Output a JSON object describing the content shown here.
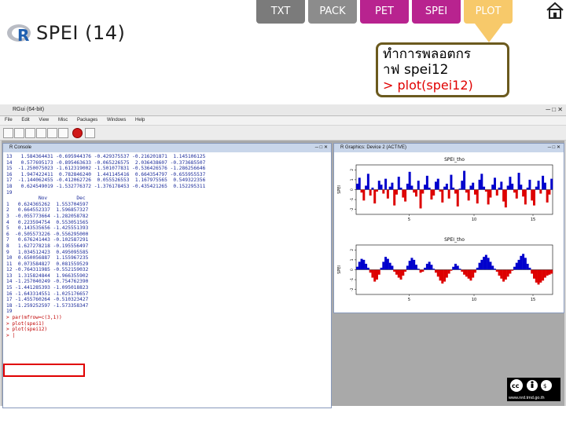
{
  "nav": {
    "tabs": [
      {
        "label": "TXT"
      },
      {
        "label": "PACK"
      },
      {
        "label": "PET"
      },
      {
        "label": "SPEI"
      },
      {
        "label": "PLOT"
      }
    ]
  },
  "slide": {
    "title": "SPEI (14)",
    "callout": {
      "line1": "ทำการพลอตกร",
      "line2": "าฟ spei12",
      "line3": "> plot(spei12)"
    }
  },
  "rgui": {
    "window_title": "RGui (64-bit)",
    "menu": [
      "File",
      "Edit",
      "View",
      "Misc",
      "Packages",
      "Windows",
      "Help"
    ],
    "console_title": "R Console",
    "graphics_title": "R Graphics: Device 2 (ACTIVE)",
    "console_lines": [
      "13   1.584364431 -0.695944376 -0.429375537 -0.216201871  1.145106125",
      "14   0.577695173 -0.895463633 -0.065226575  2.036438607 -0.373685507",
      "15  -1.250075023 -1.612319002 -1.501077831 -0.536426576 -1.286256646",
      "16   1.947422411  0.782846240  1.441145416  0.664354797 -0.655955537",
      "17  -1.144062455 -0.412062726  0.055526553  1.167975565  0.549322356",
      "18   0.624549019 -1.532776372 -1.376178453 -0.435421265  0.152295311",
      "19",
      "           Nov          Dec",
      "1   0.624365262  1.553704597",
      "2   0.664552337  1.596857327",
      "3  -0.055773664 -1.282058782",
      "4   0.223594754  0.553051565",
      "5   0.143535656 -1.425551393",
      "6  -0.505573226 -0.556295000",
      "7   0.676241443 -0.102587291",
      "8   1.627278218 -0.195556497",
      "9   1.034512423  0.495095585",
      "10  0.650056887  1.155967235",
      "11  0.073584827  0.081559529",
      "12 -0.764311985 -0.552159032",
      "13  1.315824844  1.966355902",
      "14 -1.257040249 -0.754762390",
      "15 -1.441285393 -1.095018823",
      "16 -1.643314551 -1.025176657",
      "17 -1.455760264 -0.510323427",
      "18 -1.259252597 -1.573358347",
      "19"
    ],
    "console_commands": [
      "> par(mfrow=c(3,1))",
      "> plot(spei1)",
      "> plot(spei12)",
      "> |"
    ],
    "plots": [
      {
        "title": "SPEI_tho",
        "ylabel": "SPEI",
        "y_ticks": [
          "2",
          "1",
          "0",
          "-1",
          "-2"
        ],
        "x_ticks": [
          "5",
          "10",
          "15"
        ],
        "ylim": [
          -2.5,
          2.5
        ],
        "series": [
          0.6,
          1.2,
          -0.3,
          -1.1,
          0.4,
          1.6,
          -0.6,
          0.2,
          -1.4,
          -0.2,
          0.9,
          0.5,
          -0.4,
          1.1,
          -0.9,
          0.3,
          0.7,
          -1.6,
          -0.5,
          1.3,
          0.2,
          -0.8,
          -1.2,
          0.6,
          1.8,
          0.4,
          -0.3,
          -0.7,
          0.9,
          -1.9,
          -0.4,
          0.5,
          1.4,
          0.2,
          -1.0,
          -0.6,
          0.8,
          1.1,
          -0.2,
          -1.3,
          0.3,
          0.6,
          -0.9,
          1.5,
          0.2,
          -0.4,
          -1.7,
          0.1,
          0.9,
          1.9,
          -0.3,
          -1.1,
          0.4,
          0.7,
          -0.5,
          -1.4,
          1.0,
          1.6,
          0.3,
          -0.2,
          -1.5,
          -0.8,
          0.5,
          1.2,
          -0.6,
          0.2,
          0.8,
          -1.2,
          -1.8,
          0.4,
          1.3,
          0.6,
          -0.3,
          -0.9,
          1.7,
          0.5,
          -0.7,
          -1.5,
          0.2,
          1.0,
          -1.1,
          -1.6,
          0.3,
          0.9,
          -0.4,
          1.4,
          0.7,
          -1.3,
          -0.5,
          1.1
        ],
        "positive_color": "#0000cc",
        "negative_color": "#dd0000"
      },
      {
        "title": "SPEI_tho",
        "ylabel": "SPEI",
        "y_ticks": [
          "2",
          "1",
          "0",
          "-1",
          "-2"
        ],
        "x_ticks": [
          "5",
          "10",
          "15"
        ],
        "ylim": [
          -2.5,
          2.5
        ],
        "series": [
          0.3,
          0.8,
          1.1,
          1.0,
          0.6,
          0.2,
          -0.3,
          -0.8,
          -1.2,
          -1.0,
          -0.5,
          0.2,
          0.8,
          1.3,
          1.1,
          0.7,
          0.4,
          -0.2,
          -0.5,
          -0.8,
          -1.0,
          -0.6,
          -0.2,
          0.4,
          0.9,
          1.2,
          1.0,
          0.5,
          0.1,
          -0.3,
          -0.2,
          0.2,
          0.6,
          0.8,
          0.5,
          0.1,
          -0.3,
          -0.7,
          -1.1,
          -1.4,
          -1.2,
          -0.8,
          -0.4,
          -0.1,
          0.3,
          0.6,
          0.4,
          0.1,
          -0.2,
          -0.5,
          -0.7,
          -0.9,
          -1.1,
          -0.8,
          -0.3,
          0.2,
          0.7,
          1.0,
          1.3,
          1.5,
          1.2,
          0.8,
          0.4,
          0.1,
          -0.2,
          -0.6,
          -0.9,
          -1.2,
          -1.0,
          -0.7,
          -0.4,
          -0.1,
          0.3,
          0.7,
          1.0,
          1.4,
          1.6,
          1.2,
          0.6,
          0.2,
          -0.4,
          -0.9,
          -1.3,
          -1.5,
          -1.3,
          -1.1,
          -0.8,
          -0.6,
          -0.5,
          -0.4
        ],
        "positive_color": "#0000cc",
        "negative_color": "#dd0000"
      }
    ]
  },
  "badge": {
    "url": "www.nrd.tmd.go.th"
  },
  "colors": {
    "pet_tab": "#b8238f",
    "plot_tab": "#f7c96a",
    "callout_border": "#6b5a1e",
    "command_red": "#e00000"
  }
}
